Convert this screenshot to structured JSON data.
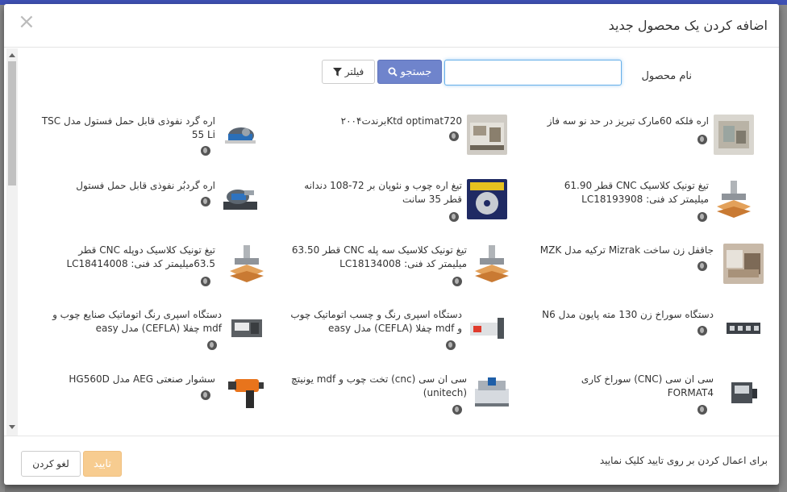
{
  "modal": {
    "title": "اضافه کردن یک محصول جدید",
    "close_glyph": "×"
  },
  "search": {
    "label": "نام محصول",
    "value": "",
    "placeholder": "",
    "search_label": "جستجو",
    "filter_label": "فیلتر"
  },
  "products": [
    {
      "name": "اره فلکه 60مارک تبریز در حد نو سه فاز"
    },
    {
      "name": "Ktd optimat720برندت۲۰۰۴"
    },
    {
      "name": "اره گرد نفوذی قابل حمل فستول مدل TSC 55 Li"
    },
    {
      "name": "تیغ تونیک کلاسیک CNC قطر 61.90 میلیمتر کد فنی: LC18193908"
    },
    {
      "name": "تیغ اره چوب و نئوپان بر 72-108 دندانه قطر 35 سانت"
    },
    {
      "name": "اره گردبُر نفوذی قابل حمل فستول"
    },
    {
      "name": "جاقفل زن ساخت Mizrak ترکیه مدل MZK"
    },
    {
      "name": "تیغ تونیک کلاسیک سه پله CNC قطر 63.50 میلیمتر کد فنی: LC18134008"
    },
    {
      "name": "تیغ تونیک کلاسیک دوپله CNC قطر 63.5میلیمتر کد فنی: LC18414008"
    },
    {
      "name": "دستگاه سوراخ زن 130 مته پایون مدل N6"
    },
    {
      "name": "دستگاه اسپری رنگ و چسب اتوماتیک چوب و mdf چفلا (CEFLA) مدل easy"
    },
    {
      "name": "دستگاه اسپری رنگ اتوماتیک صنایع چوب و mdf چفلا (CEFLA) مدل easy"
    },
    {
      "name": "سی ان سی (CNC) سوراخ کاری FORMAT4"
    },
    {
      "name": "سی ان سی (cnc) تخت چوب و mdf یونیتچ (unitech)"
    },
    {
      "name": "سشوار صنعتی AEG مدل HG560D"
    }
  ],
  "footer": {
    "note": "برای اعمال کردن بر روی تایید کلیک نمایید",
    "confirm_label": "تایید",
    "cancel_label": "لغو کردن"
  }
}
